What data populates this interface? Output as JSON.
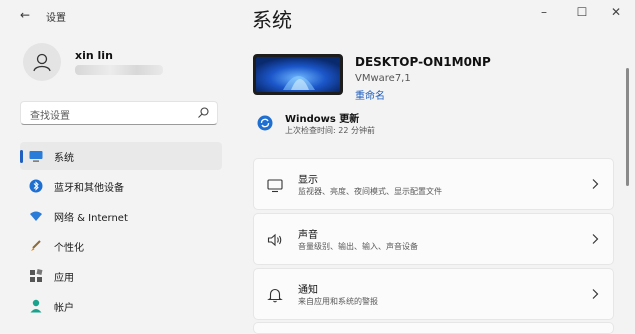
{
  "window": {
    "app_title": "设置",
    "back_icon": "back-arrow-icon",
    "minimize_symbol": "–",
    "maximize_symbol": "☐",
    "close_symbol": "✕"
  },
  "sidebar": {
    "user": {
      "name": "xin lin",
      "avatar_icon": "person-icon"
    },
    "search": {
      "placeholder": "查找设置",
      "icon": "search-icon"
    },
    "items": [
      {
        "label": "系统",
        "icon": "monitor-icon",
        "active": true
      },
      {
        "label": "蓝牙和其他设备",
        "icon": "bluetooth-icon",
        "active": false
      },
      {
        "label": "网络 & Internet",
        "icon": "wifi-icon",
        "active": false
      },
      {
        "label": "个性化",
        "icon": "brush-icon",
        "active": false
      },
      {
        "label": "应用",
        "icon": "apps-icon",
        "active": false
      },
      {
        "label": "帐户",
        "icon": "account-icon",
        "active": false
      }
    ]
  },
  "main": {
    "page_title": "系统",
    "device": {
      "name": "DESKTOP-ON1M0NP",
      "model": "VMware7,1",
      "rename_label": "重命名"
    },
    "update": {
      "title": "Windows 更新",
      "subtitle": "上次检查时间: 22 分钟前"
    },
    "cards": [
      {
        "title": "显示",
        "subtitle": "监视器、亮度、夜间模式、显示配置文件",
        "icon": "display-icon"
      },
      {
        "title": "声音",
        "subtitle": "音量级别、输出、输入、声音设备",
        "icon": "speaker-icon"
      },
      {
        "title": "通知",
        "subtitle": "来自应用和系统的警报",
        "icon": "bell-icon"
      }
    ]
  },
  "colors": {
    "accent": "#1f5fbf",
    "background": "#f3f3f3",
    "card": "#fbfbfb"
  }
}
